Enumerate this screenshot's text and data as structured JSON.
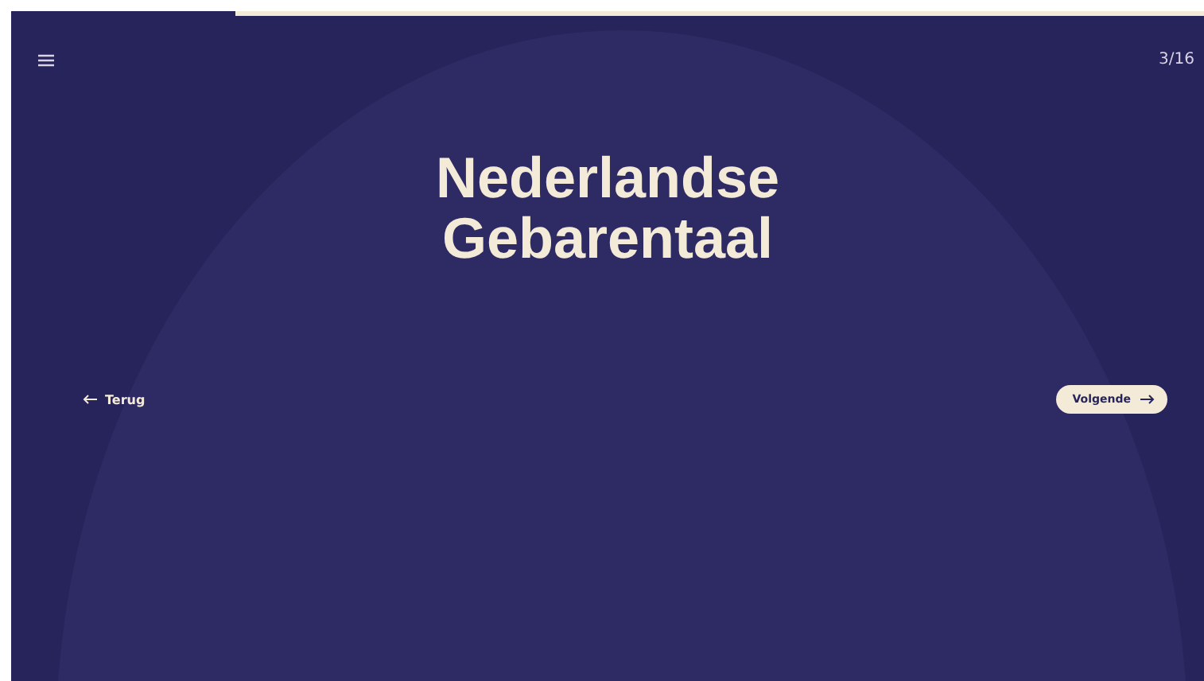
{
  "progress": {
    "level": 0.1875
  },
  "header": {
    "counter": "3/16"
  },
  "slide": {
    "title": "Nederlandse Gebarentaal"
  },
  "navigation": {
    "back": "Terug",
    "next": "Volgende"
  }
}
